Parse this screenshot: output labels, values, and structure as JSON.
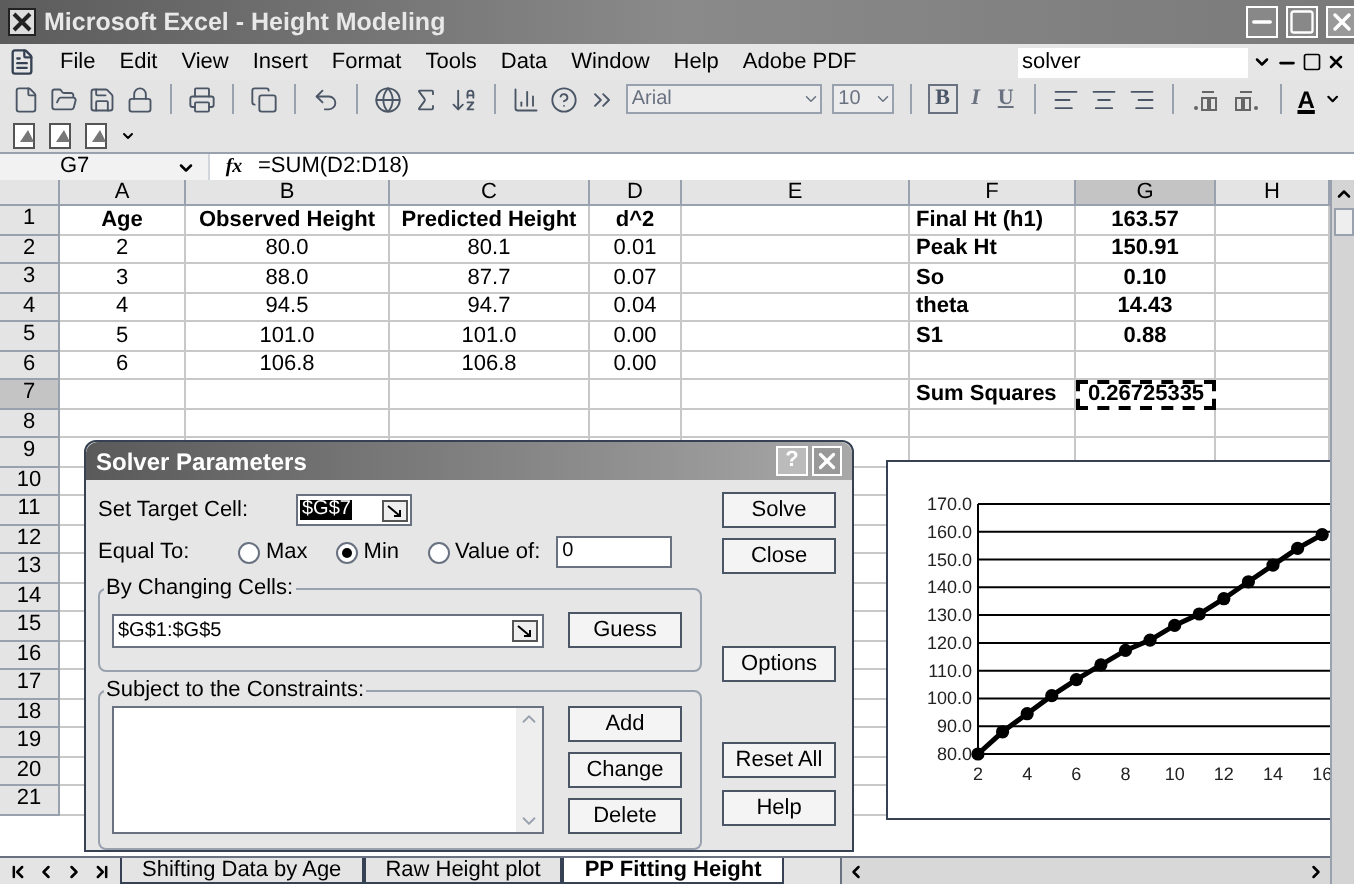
{
  "window": {
    "title": "Microsoft Excel - Height Modeling"
  },
  "menu": {
    "items": [
      "File",
      "Edit",
      "View",
      "Insert",
      "Format",
      "Tools",
      "Data",
      "Window",
      "Help",
      "Adobe PDF"
    ],
    "help_search": "solver"
  },
  "toolbar": {
    "font": "Arial",
    "size": "10",
    "bold": "B",
    "italic": "I",
    "underline": "U",
    "font_color": "A"
  },
  "formula_bar": {
    "name_box": "G7",
    "fx": "fx",
    "formula": "=SUM(D2:D18)"
  },
  "sheet": {
    "columns": [
      {
        "label": "A",
        "selected": false
      },
      {
        "label": "B",
        "selected": false
      },
      {
        "label": "C",
        "selected": false
      },
      {
        "label": "D",
        "selected": false
      },
      {
        "label": "E",
        "selected": false
      },
      {
        "label": "F",
        "selected": false
      },
      {
        "label": "G",
        "selected": true
      },
      {
        "label": "H",
        "selected": false
      }
    ],
    "rows": [
      {
        "label": "1",
        "selected": false
      },
      {
        "label": "2",
        "selected": false
      },
      {
        "label": "3",
        "selected": false
      },
      {
        "label": "4",
        "selected": false
      },
      {
        "label": "5",
        "selected": false
      },
      {
        "label": "6",
        "selected": false
      },
      {
        "label": "7",
        "selected": true
      },
      {
        "label": "8",
        "selected": false
      },
      {
        "label": "9",
        "selected": false
      },
      {
        "label": "10",
        "selected": false
      },
      {
        "label": "11",
        "selected": false
      },
      {
        "label": "12",
        "selected": false
      },
      {
        "label": "13",
        "selected": false
      },
      {
        "label": "14",
        "selected": false
      },
      {
        "label": "15",
        "selected": false
      },
      {
        "label": "16",
        "selected": false
      },
      {
        "label": "17",
        "selected": false
      },
      {
        "label": "18",
        "selected": false
      },
      {
        "label": "19",
        "selected": false
      },
      {
        "label": "20",
        "selected": false
      },
      {
        "label": "21",
        "selected": false
      }
    ],
    "headers": [
      "Age",
      "Observed Height",
      "Predicted Height",
      "d^2"
    ],
    "data_rows": [
      [
        "2",
        "80.0",
        "80.1",
        "0.01"
      ],
      [
        "3",
        "88.0",
        "87.7",
        "0.07"
      ],
      [
        "4",
        "94.5",
        "94.7",
        "0.04"
      ],
      [
        "5",
        "101.0",
        "101.0",
        "0.00"
      ],
      [
        "6",
        "106.8",
        "106.8",
        "0.00"
      ]
    ],
    "parameters": [
      {
        "label": "Final Ht (h1)",
        "value": "163.57"
      },
      {
        "label": "Peak Ht",
        "value": "150.91"
      },
      {
        "label": "So",
        "value": "0.10"
      },
      {
        "label": "theta",
        "value": "14.43"
      },
      {
        "label": "S1",
        "value": "0.88"
      }
    ],
    "sum_squares": {
      "label": "Sum Squares",
      "value": "0.26725335",
      "active": true
    }
  },
  "chart": {
    "chart_data": {
      "type": "line",
      "x": [
        2,
        3,
        4,
        5,
        6,
        7,
        8,
        9,
        10,
        11,
        12,
        13,
        14,
        15,
        16
      ],
      "grid": true,
      "series": [
        {
          "color": "#000000",
          "marker": true,
          "values": [
            80.0,
            88.0,
            94.5,
            101.0,
            106.8,
            112.1,
            117.3,
            121.0,
            126.3,
            130.4,
            135.9,
            142.0,
            148.0,
            154.0,
            159.0
          ]
        }
      ],
      "xlim": [
        2,
        16.4
      ],
      "ylim": [
        80,
        170
      ],
      "xticks": [
        2,
        4,
        6,
        8,
        10,
        12,
        14,
        16
      ],
      "yticks": [
        {
          "value": 80,
          "label": "80.0"
        },
        {
          "value": 90,
          "label": "90.0"
        },
        {
          "value": 100,
          "label": "100.0"
        },
        {
          "value": 110,
          "label": "110.0"
        },
        {
          "value": 120,
          "label": "120.0"
        },
        {
          "value": 130,
          "label": "130.0"
        },
        {
          "value": 140,
          "label": "140.0"
        },
        {
          "value": 150,
          "label": "150.0"
        },
        {
          "value": 160,
          "label": "160.0"
        },
        {
          "value": 170,
          "label": "170.0"
        }
      ]
    }
  },
  "dialog": {
    "title": "Solver Parameters",
    "help": "?",
    "target": {
      "label": "Set Target Cell:",
      "value": "$G$7",
      "selected": true
    },
    "equal_to": {
      "label": "Equal To:",
      "options": [
        {
          "label": "Max",
          "selected": false
        },
        {
          "label": "Min",
          "selected": true
        },
        {
          "label": "Value of:",
          "selected": false
        }
      ],
      "value": "0"
    },
    "changing": {
      "label": "By Changing Cells:",
      "value": "$G$1:$G$5",
      "button": "Guess"
    },
    "constraints": {
      "label": "Subject to the Constraints:",
      "buttons": [
        "Add",
        "Change",
        "Delete"
      ]
    },
    "side_buttons": [
      "Solve",
      "Close",
      "Options",
      "Reset All",
      "Help"
    ]
  },
  "sheet_tabs": [
    {
      "label": "Shifting Data by Age",
      "selected": false
    },
    {
      "label": "Raw Height plot",
      "selected": false
    },
    {
      "label": "PP Fitting Height",
      "selected": true
    }
  ]
}
